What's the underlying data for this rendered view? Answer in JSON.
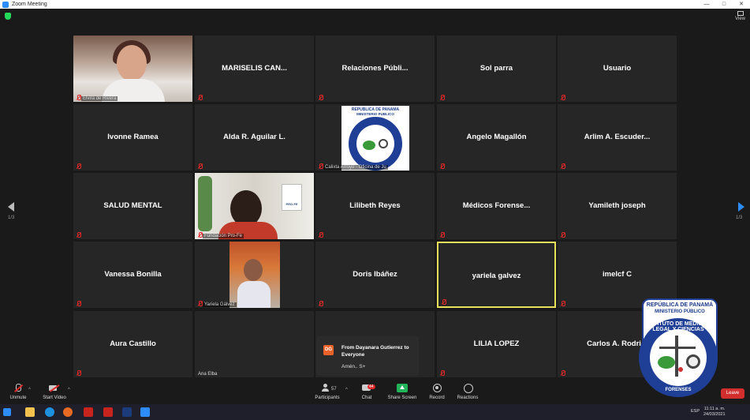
{
  "window": {
    "title": "Zoom Meeting",
    "view_label": "View"
  },
  "tiles": [
    {
      "name": "Elvira de Rivera",
      "video": true
    },
    {
      "name": "MARISELIS  CAN..."
    },
    {
      "name": "Relaciones  Públi..."
    },
    {
      "name": "Sol parra"
    },
    {
      "name": "Usuario"
    },
    {
      "name": "Ivonne Ramea"
    },
    {
      "name": "Alda R. Aguilar L."
    },
    {
      "name": "Calixta Arroyo - Oficina de Ju",
      "video": true
    },
    {
      "name": "Angelo Magallón"
    },
    {
      "name": "Arlim  A. Escuder..."
    },
    {
      "name": "SALUD MENTAL"
    },
    {
      "name": "Fundación Pro-Fe",
      "video": true
    },
    {
      "name": "Lilibeth Reyes"
    },
    {
      "name": "Médicos  Forense..."
    },
    {
      "name": "Yamileth joseph"
    },
    {
      "name": "Vanessa Bonilla"
    },
    {
      "name": "Yariela Gálvez",
      "video": true
    },
    {
      "name": "Doris Ibáñez"
    },
    {
      "name": "yariela galvez",
      "active": true
    },
    {
      "name": "imelcf C"
    },
    {
      "name": "Aura Castillo"
    },
    {
      "name": "Ana Elba"
    },
    {
      "name": ""
    },
    {
      "name": "LILIA LOPEZ"
    },
    {
      "name": "Carlos  A. Rodri..."
    }
  ],
  "logo": {
    "line1": "REPUBLICA DE PANAMA",
    "line2": "MINISTERIO PUBLICO",
    "big_line1": "REPÚBLICA DE PANAMÁ",
    "big_line2": "MINISTERIO PÚBLICO",
    "ring_top": "INSTITUTO DE MEDICINA LEGAL Y CIENCIAS",
    "ring_bottom": "FORENSES",
    "poster_text": "PRO-FE"
  },
  "pager": {
    "left": "1/3",
    "right": "1/3"
  },
  "chat_popup": {
    "initials": "DG",
    "from": "From Dayanara Gutierrez to Everyone",
    "message": "Amén.. S+"
  },
  "toolbar": {
    "unmute": "Unmute",
    "start_video": "Start Video",
    "participants": "Participants",
    "participants_count": "57",
    "chat": "Chat",
    "chat_badge": "44",
    "share": "Share Screen",
    "record": "Record",
    "reactions": "Reactions",
    "leave": "Leave"
  },
  "taskbar": {
    "lang": "ESP",
    "time": "11:11 a. m.",
    "date": "24/03/2021"
  },
  "colors": {
    "accent": "#2d8cff",
    "muted": "#e02828",
    "active_border": "#e8e05a",
    "share": "#23b359",
    "leave": "#d32e2e"
  }
}
